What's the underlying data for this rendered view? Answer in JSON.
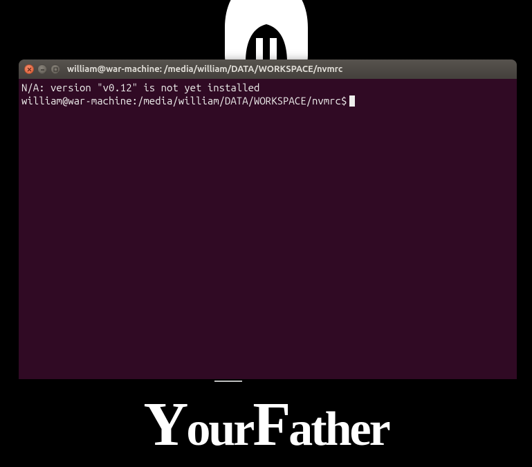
{
  "desktop": {
    "wallpaper_text_top": "Your",
    "wallpaper_text_bottom": "Father"
  },
  "terminal": {
    "title": "william@war-machine: /media/william/DATA/WORKSPACE/nvmrc",
    "output_line1": "N/A: version \"v0.12\" is not yet installed",
    "prompt": "william@war-machine:/media/william/DATA/WORKSPACE/nvmrc$"
  },
  "colors": {
    "terminal_bg": "#300a24",
    "terminal_fg": "#eeeeec",
    "close_btn": "#e35e33",
    "titlebar": "#44403c"
  }
}
